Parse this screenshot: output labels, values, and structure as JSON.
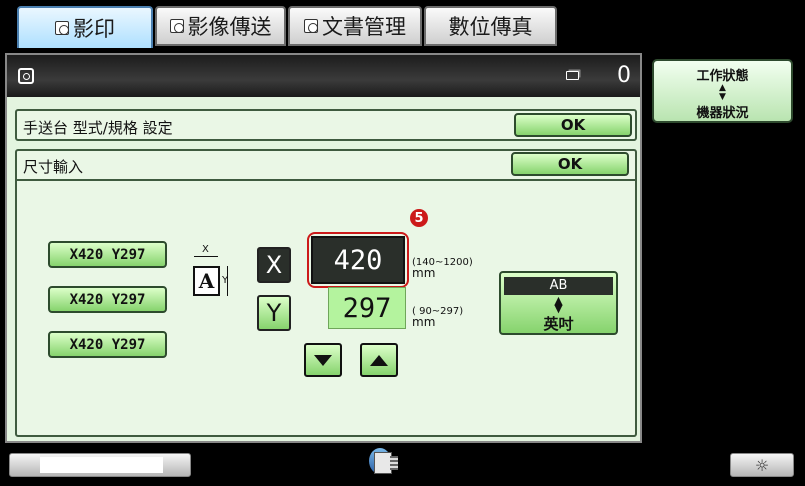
{
  "tabs": [
    {
      "label": "影印",
      "active": true
    },
    {
      "label": "影像傳送",
      "active": false
    },
    {
      "label": "文書管理",
      "active": false
    },
    {
      "label": "數位傳真",
      "active": false
    }
  ],
  "titlebar": {
    "copy_count": "0"
  },
  "status_panel": {
    "line1": "工作狀態",
    "arrows": "◆",
    "line2": "機器狀況"
  },
  "settings": {
    "row1": {
      "label": "手送台 型式/規格 設定",
      "ok": "OK"
    },
    "row2": {
      "label": "尺寸輸入",
      "ok": "OK"
    }
  },
  "presets": [
    "X420 Y297",
    "X420 Y297",
    "X420 Y297"
  ],
  "diagram": {
    "x_label": "X",
    "y_label": "Y",
    "paper_letter": "A"
  },
  "inputs": {
    "x_button": "X",
    "y_button": "Y",
    "x_value": "420",
    "y_value": "297",
    "x_range": "(140~1200)",
    "y_range": "( 90~297)",
    "unit": "mm"
  },
  "callout": "5",
  "unit_toggle": {
    "top": "AB",
    "bottom": "英吋"
  },
  "colors": {
    "accent_green": "#86d36d",
    "callout_red": "#cc1a1a",
    "value_bg": "#2a2f2a"
  }
}
